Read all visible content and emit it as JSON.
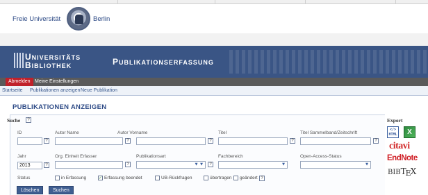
{
  "header": {
    "fu_left": "Freie Universität",
    "fu_right": "Berlin"
  },
  "banner": {
    "ub_first_big": "U",
    "ub_first_rest": "NIVERSITÄTS",
    "ub_second_big": "B",
    "ub_second_rest": "IBLIOTHEK",
    "title_big": "P",
    "title_rest": "UBLIKATIONSERFASSUNG"
  },
  "user_bar": {
    "logout": "Abmelden",
    "settings": "Meine Einstellungen"
  },
  "nav": {
    "home": "Startseite",
    "show": "Publikationen anzeigen",
    "new": "Neue Publikation"
  },
  "page": {
    "title": "PUBLIKATIONEN ANZEIGEN"
  },
  "search": {
    "heading": "Suche",
    "help": "?",
    "labels": {
      "id": "ID",
      "author_name": "Autor Name",
      "author_firstname": "Autor Vorname",
      "title": "Titel",
      "collection_title": "Titel Sammelband/Zeitschrift",
      "year": "Jahr",
      "org_unit": "Org. Einheit Erfasser",
      "pub_type": "Publikationsart",
      "field": "Fachbereich",
      "oa_status": "Open-Access-Status",
      "status": "Status"
    },
    "values": {
      "year": "2013"
    },
    "status_options": [
      {
        "label": "in Erfassung",
        "checked": false
      },
      {
        "label": "Erfassung beendet",
        "checked": true
      },
      {
        "label": "UB-Rückfragen",
        "checked": false
      },
      {
        "label": "übertragen",
        "checked": false
      },
      {
        "label": "geändert",
        "checked": false
      }
    ],
    "buttons": {
      "clear": "Löschen",
      "search": "Suchen"
    }
  },
  "export": {
    "heading": "Export",
    "html_icon_top": "</>",
    "html_icon_bottom": "HTML",
    "excel_icon": "X",
    "citavi": "citavi",
    "endnote": "EndNote",
    "bibtex_a": "BIB",
    "bibtex_b": "T",
    "bibtex_c": "E",
    "bibtex_d": "X"
  },
  "colors": {
    "banner": "#3a5585",
    "accent_red": "#c0212a",
    "link_blue": "#3b5a8e",
    "fu_green": "#7da13a"
  }
}
